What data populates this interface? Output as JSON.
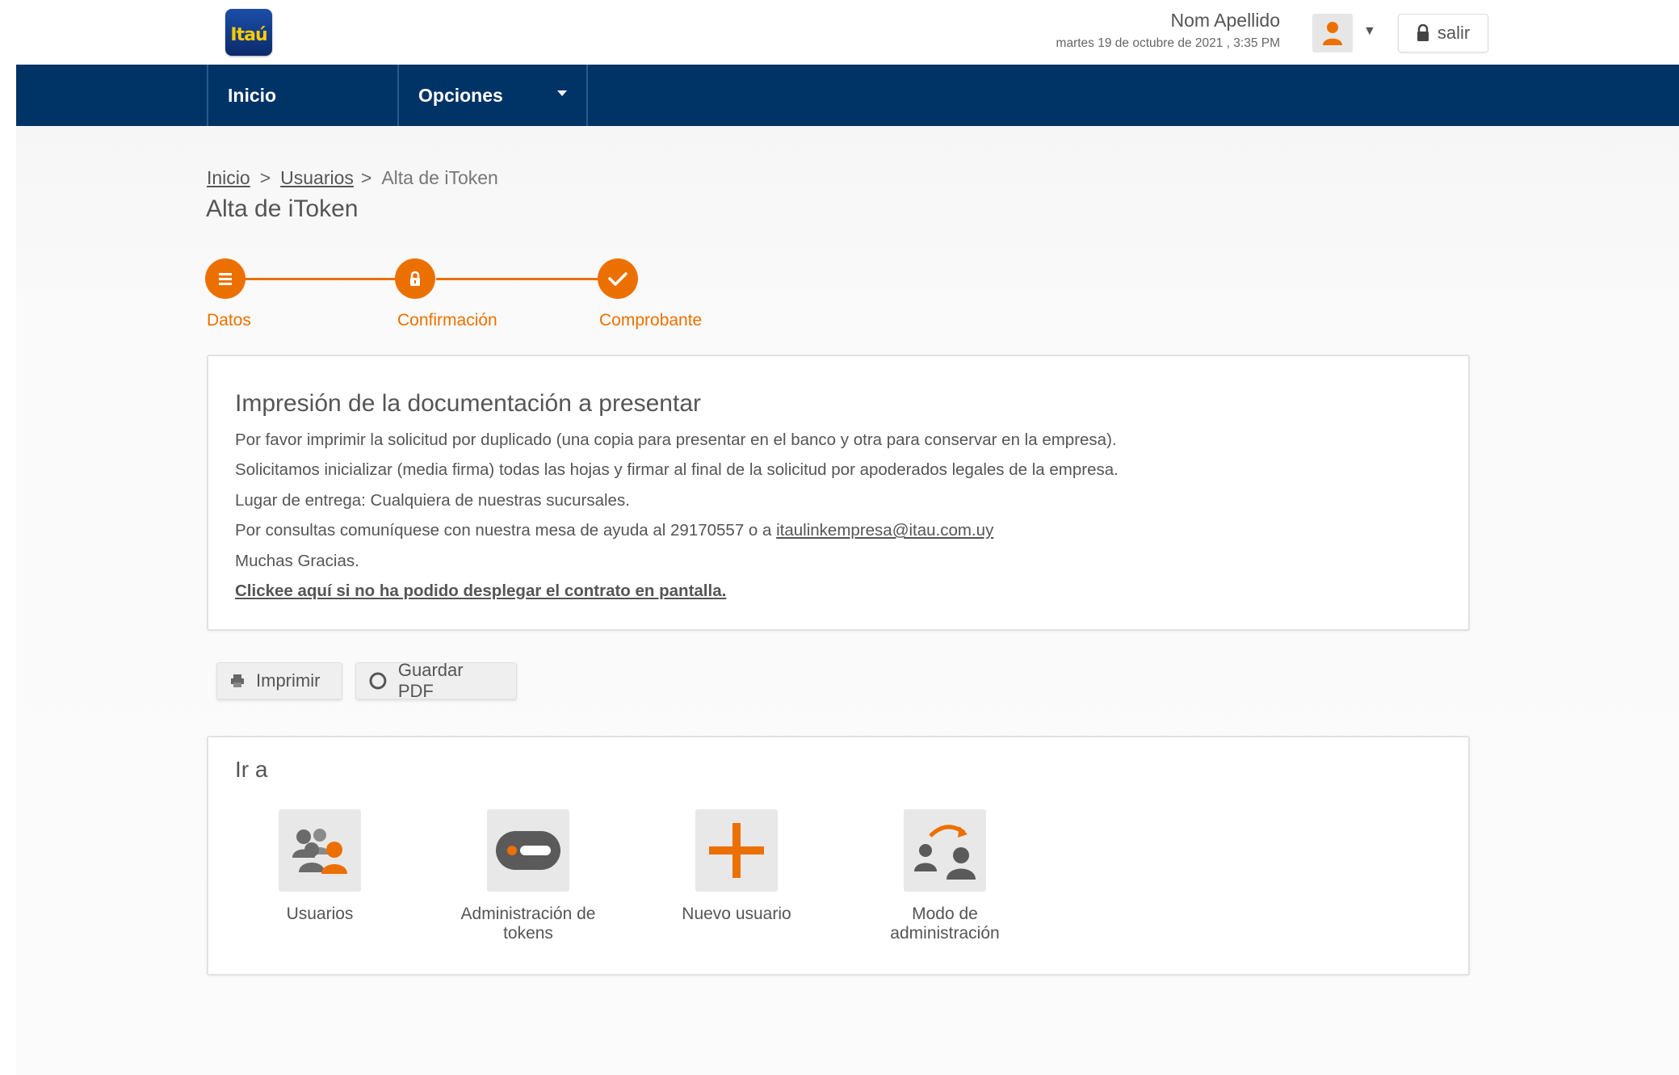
{
  "app": {
    "logo_text": "Itaú"
  },
  "user": {
    "name": "Nom Apellido",
    "datetime": "martes 19 de octubre de 2021 , 3:35 PM",
    "logout_label": "salir"
  },
  "nav": {
    "items": [
      {
        "label": "Inicio"
      },
      {
        "label": "Opciones"
      }
    ]
  },
  "breadcrumb": [
    {
      "label": "Inicio"
    },
    {
      "label": "Usuarios"
    },
    {
      "label": "Alta de iToken"
    }
  ],
  "page": {
    "title": "Alta de iToken"
  },
  "stepper": {
    "steps": [
      {
        "label": "Datos",
        "icon": "list-icon"
      },
      {
        "label": "Confirmación",
        "icon": "lock-icon"
      },
      {
        "label": "Comprobante",
        "icon": "check-icon"
      }
    ]
  },
  "documentation": {
    "title": "Impresión de la documentación a presentar",
    "lines": [
      "Por favor imprimir la solicitud por duplicado (una copia para presentar en el banco y otra para conservar en la empresa).",
      "Solicitamos inicializar (media firma) todas las hojas y firmar al final de la solicitud por apoderados legales de la empresa.",
      "Lugar de entrega: Cualquiera de nuestras sucursales.",
      "Muchas Gracias."
    ],
    "contact_prefix": "Por consultas comuníquese con nuestra mesa de ayuda al 29170557 o a ",
    "contact_email": "itaulinkempresa@itau.com.uy",
    "contract_link": "Clickee aquí si no ha podido desplegar el contrato en pantalla."
  },
  "actions": {
    "print_label": "Imprimir",
    "pdf_label": "Guardar PDF"
  },
  "goto": {
    "title": "Ir a",
    "tiles": [
      {
        "label": "Usuarios",
        "icon": "users-icon"
      },
      {
        "label": "Administración de tokens",
        "icon": "token-icon"
      },
      {
        "label": "Nuevo usuario",
        "icon": "plus-icon"
      },
      {
        "label": "Modo de administración",
        "icon": "user-switch-icon"
      }
    ]
  },
  "colors": {
    "brand_orange": "#ec7000",
    "nav_blue": "#003366",
    "logo_yellow": "#ffcc00"
  }
}
